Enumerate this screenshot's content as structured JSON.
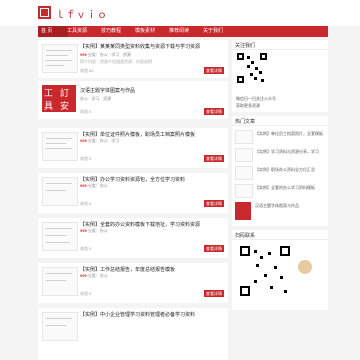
{
  "site": {
    "logo_text": "ｌｆｖｉｏ"
  },
  "nav": [
    {
      "label": "首 页"
    },
    {
      "label": "工具资源"
    },
    {
      "label": "技巧教程"
    },
    {
      "label": "模板素材"
    },
    {
      "label": "推荐阅读"
    },
    {
      "label": "关于我们"
    }
  ],
  "posts": [
    {
      "title": "【实例】某某某同类型资料收集与资源下载与学习资源",
      "tag": "",
      "price": "¥99",
      "meta": "分类：办公 · 学习 · 资源",
      "desc": "简介内容：资源介绍描述资源，内容说明",
      "views": "浏览 62",
      "button": "查看详情"
    },
    {
      "title": "汉语主题字体图案与作品",
      "tag": "",
      "price": "",
      "meta": "办公 · 学习 · 资源",
      "desc": "",
      "views": "浏览 0",
      "button": "查看详情"
    },
    {
      "title": "【实例】单位证件照片模板，职场员工档案照片模板",
      "tag": "",
      "price": "¥99",
      "meta": "分类：办公 · 学习",
      "desc": "",
      "views": "浏览 0",
      "button": "查看详情"
    },
    {
      "title": "【实例】办公学习资料资源包，全方位学习资料",
      "tag": "",
      "price": "¥99",
      "meta": "分类：办公",
      "desc": "",
      "views": "浏览 0",
      "button": "查看详情"
    },
    {
      "title": "【实例】全套的办公资料模板下载地址，学习资料资源",
      "tag": "",
      "price": "¥99",
      "meta": "分类：办公",
      "desc": "",
      "views": "浏览 0",
      "button": "查看详情"
    },
    {
      "title": "【实例】工作总结报告，年度总结报告模板",
      "tag": "",
      "price": "¥99",
      "meta": "分类：办公",
      "desc": "",
      "views": "浏览 0",
      "button": "查看详情"
    },
    {
      "title": "【实例】中小企业管理学习资料管理者必备学习资料",
      "tag": "",
      "price": "",
      "meta": "分类：办公",
      "desc": "",
      "views": "",
      "button": ""
    }
  ],
  "sidebar": {
    "follow_title": "关注我们",
    "follow_lines": [
      "微信扫一扫关注公众号",
      "获取更多资源"
    ],
    "hot_title": "热门文章",
    "hot_items": [
      {
        "text": "【实例】单位员工档案照片，全套模板"
      },
      {
        "text": "【实例】学习资料与资源分享，学习"
      },
      {
        "text": "【实例】职场办公资料全方位汇总"
      },
      {
        "text": "【实例】全套的办公学习资料模板"
      },
      {
        "text": "汉语主题字体图案与作品"
      }
    ],
    "qr_title": "扫码联系"
  },
  "colors": {
    "accent": "#c9282d",
    "background": "#f4f4f4"
  }
}
